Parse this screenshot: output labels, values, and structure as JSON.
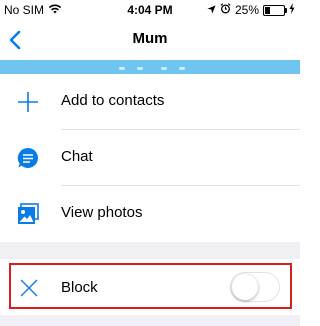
{
  "status_bar": {
    "carrier": "No SIM",
    "time": "4:04 PM",
    "battery_percent": "25%",
    "battery_level": 0.25,
    "icons": [
      "wifi-icon",
      "location-arrow-icon",
      "alarm-icon",
      "battery-icon",
      "charging-bolt-icon"
    ]
  },
  "nav": {
    "back_icon": "chevron-left-icon",
    "title": "Mum"
  },
  "actions": [
    {
      "icon": "plus-icon",
      "label": "Add to contacts"
    },
    {
      "icon": "chat-bubble-icon",
      "label": "Chat"
    },
    {
      "icon": "photo-icon",
      "label": "View photos"
    }
  ],
  "block": {
    "icon": "x-icon",
    "label": "Block",
    "toggle_on": false
  },
  "colors": {
    "accent": "#0a7ce8",
    "header_strip": "#6fc4f0",
    "highlight_border": "#d32020",
    "section_gap": "#efeff4"
  }
}
